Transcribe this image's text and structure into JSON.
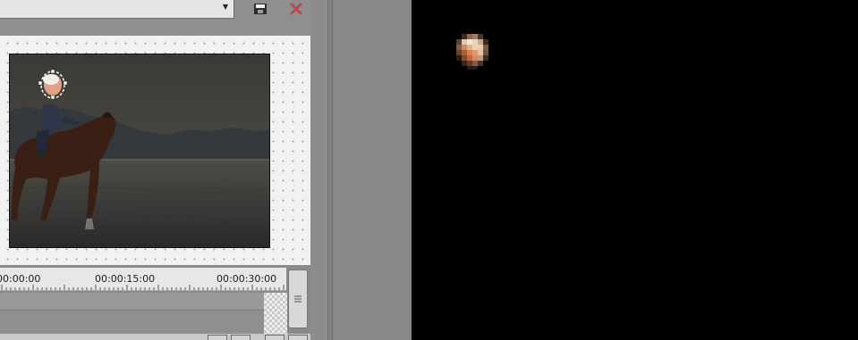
{
  "toolbar": {
    "preset_value": "",
    "save_icon": "save-icon",
    "close_icon": "close-icon",
    "close_color": "#b84a4a"
  },
  "timeline": {
    "ruler_labels": [
      "00:00:00",
      "00:00:15:00",
      "00:00:30:00"
    ]
  },
  "colors": {
    "workspace_bg": "#f2f2f2",
    "preview_bg": "#000000",
    "panel_bg": "#8d8d8d"
  }
}
